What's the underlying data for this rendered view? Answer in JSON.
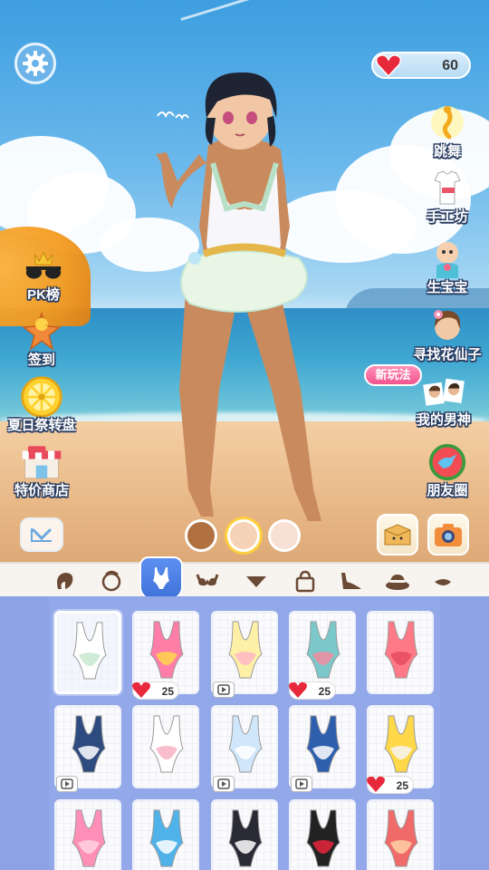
{
  "hud": {
    "hearts_value": "60",
    "settings_icon": "gear-icon"
  },
  "left_menu": [
    {
      "label": "PK榜",
      "icon": "sunglasses-crown-icon"
    },
    {
      "label": "签到",
      "icon": "starfish-chick-icon"
    },
    {
      "label": "夏日祭转盘",
      "icon": "lemon-wheel-icon"
    },
    {
      "label": "特价商店",
      "icon": "shop-icon"
    }
  ],
  "right_menu": [
    {
      "label": "跳舞",
      "icon": "dance-icon"
    },
    {
      "label": "手工坊",
      "icon": "workshop-icon"
    },
    {
      "label": "生宝宝",
      "icon": "baby-icon"
    },
    {
      "label": "寻找花仙子",
      "icon": "flower-fairy-icon"
    },
    {
      "label": "我的男神",
      "icon": "boyfriend-icon"
    },
    {
      "label": "朋友圈",
      "icon": "watermelon-bird-icon"
    }
  ],
  "new_badge": "新玩法",
  "skin_tones": [
    "#b0703f",
    "#f6d3b6",
    "#f9e0d4"
  ],
  "categories": [
    "hair-icon",
    "face-icon",
    "swimsuit-icon",
    "top-icon",
    "bottom-icon",
    "bag-icon",
    "shoes-icon",
    "hat-icon",
    "accessory-icon"
  ],
  "active_category": "swimsuit-icon",
  "items": [
    {
      "tag": "none",
      "selected": true
    },
    {
      "tag": "price",
      "price": "25"
    },
    {
      "tag": "video"
    },
    {
      "tag": "price",
      "price": "25"
    },
    {
      "tag": "none"
    },
    {
      "tag": "video"
    },
    {
      "tag": "none"
    },
    {
      "tag": "video"
    },
    {
      "tag": "video"
    },
    {
      "tag": "price",
      "price": "25"
    },
    {
      "tag": "price"
    },
    {
      "tag": "price"
    },
    {
      "tag": "price"
    },
    {
      "tag": "price"
    },
    {
      "tag": "price"
    }
  ],
  "colors": {
    "accent": "#4a7fe3",
    "heart": "#e8283b",
    "panel": "#8da2e4"
  }
}
